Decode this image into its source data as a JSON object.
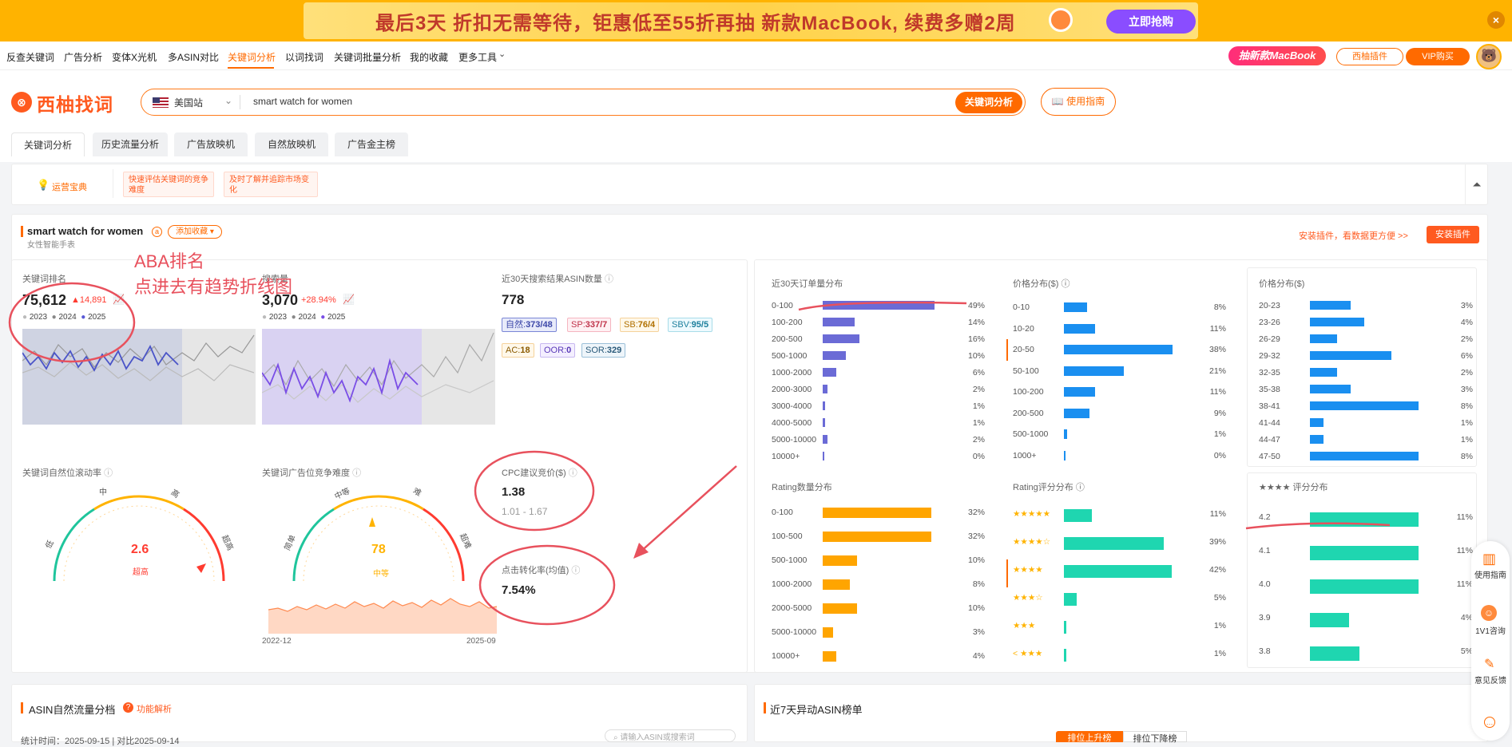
{
  "banner": {
    "text": "最后3天 折扣无需等待，钜惠低至55折再抽 新款MacBook, 续费多赠2周",
    "cta": "立即抢购",
    "close": "×"
  },
  "nav": {
    "items": [
      "反查关键词",
      "广告分析",
      "变体X光机",
      "多ASIN对比",
      "关键词分析",
      "以词找词",
      "关键词批量分析",
      "我的收藏",
      "更多工具"
    ],
    "active": "关键词分析",
    "promo": "抽新款MacBook",
    "plugin": "西柚插件",
    "vip": "VIP购买"
  },
  "search": {
    "logo": "西柚找词",
    "site": "美国站",
    "query": "smart watch for women",
    "button": "关键词分析",
    "guide": "使用指南"
  },
  "tabs": [
    "关键词分析",
    "历史流量分析",
    "广告放映机",
    "自然放映机",
    "广告金主榜"
  ],
  "tips": {
    "title": "运营宝典",
    "items": [
      "快速评估关键词的竞争难度",
      "及时了解并追踪市场变化"
    ]
  },
  "keyword": {
    "name": "smart watch for women",
    "translation": "女性智能手表",
    "fav": "添加收藏",
    "install_hint": "安装插件，看数据更方便 >>",
    "install_btn": "安装插件"
  },
  "aba": {
    "label": "关键词排名",
    "value": "75,612",
    "change": "▲14,891",
    "years": [
      "2023",
      "2024",
      "2025"
    ]
  },
  "search_vol": {
    "label": "搜索量",
    "value": "3,070",
    "change": "+28.94%",
    "years": [
      "2023",
      "2024",
      "2025"
    ]
  },
  "asin_count": {
    "label": "近30天搜索结果ASIN数量",
    "value": "778",
    "chips": [
      {
        "k": "自然",
        "v": "373/48"
      },
      {
        "k": "SP",
        "v": "337/7"
      },
      {
        "k": "SB",
        "v": "76/4"
      },
      {
        "k": "SBV",
        "v": "95/5"
      },
      {
        "k": "AC",
        "v": "18"
      },
      {
        "k": "OOR",
        "v": "0"
      },
      {
        "k": "SOR",
        "v": "329"
      }
    ]
  },
  "natural_rank": {
    "label": "关键词自然位滚动率",
    "value": "2.6",
    "level": "超高",
    "gauge": [
      "低",
      "中",
      "高",
      "超高"
    ]
  },
  "ad_compete": {
    "label": "关键词广告位竞争难度",
    "value": "78",
    "level": "中等",
    "gauge": [
      "简单",
      "中等",
      "难",
      "超难"
    ],
    "x_start": "2022-12",
    "x_end": "2025-09"
  },
  "cpc": {
    "label": "CPC建议竞价($)",
    "value": "1.38",
    "range": "1.01 - 1.67"
  },
  "cvr": {
    "label": "点击转化率(均值)",
    "value": "7.54%"
  },
  "orders_dist": {
    "title": "近30天订单量分布",
    "rows": [
      [
        "0-100",
        "49%"
      ],
      [
        "100-200",
        "14%"
      ],
      [
        "200-500",
        "16%"
      ],
      [
        "500-1000",
        "10%"
      ],
      [
        "1000-2000",
        "6%"
      ],
      [
        "2000-3000",
        "2%"
      ],
      [
        "3000-4000",
        "1%"
      ],
      [
        "4000-5000",
        "1%"
      ],
      [
        "5000-10000",
        "2%"
      ],
      [
        "10000+",
        "0%"
      ]
    ]
  },
  "price_dist": {
    "title": "价格分布($)",
    "rows": [
      [
        "0-10",
        "8%"
      ],
      [
        "10-20",
        "11%"
      ],
      [
        "20-50",
        "38%"
      ],
      [
        "50-100",
        "21%"
      ],
      [
        "100-200",
        "11%"
      ],
      [
        "200-500",
        "9%"
      ],
      [
        "500-1000",
        "1%"
      ],
      [
        "1000+",
        "0%"
      ]
    ]
  },
  "price_dist2": {
    "title": "价格分布($)",
    "rows": [
      [
        "20-23",
        "3%"
      ],
      [
        "23-26",
        "4%"
      ],
      [
        "26-29",
        "2%"
      ],
      [
        "29-32",
        "6%"
      ],
      [
        "32-35",
        "2%"
      ],
      [
        "35-38",
        "3%"
      ],
      [
        "38-41",
        "8%"
      ],
      [
        "41-44",
        "1%"
      ],
      [
        "44-47",
        "1%"
      ],
      [
        "47-50",
        "8%"
      ]
    ]
  },
  "rating_count": {
    "title": "Rating数量分布",
    "rows": [
      [
        "0-100",
        "32%"
      ],
      [
        "100-500",
        "32%"
      ],
      [
        "500-1000",
        "10%"
      ],
      [
        "1000-2000",
        "8%"
      ],
      [
        "2000-5000",
        "10%"
      ],
      [
        "5000-10000",
        "3%"
      ],
      [
        "10000+",
        "4%"
      ]
    ]
  },
  "rating_score": {
    "title": "Rating评分分布",
    "rows": [
      [
        "★★★★★",
        "11%"
      ],
      [
        "★★★★☆",
        "39%"
      ],
      [
        "★★★★",
        "42%"
      ],
      [
        "★★★☆",
        "5%"
      ],
      [
        "★★★",
        "1%"
      ],
      [
        "< ★★★",
        "1%"
      ]
    ]
  },
  "score_dist": {
    "title": "★★★★ 评分分布",
    "rows": [
      [
        "4.2",
        "11%"
      ],
      [
        "4.1",
        "11%"
      ],
      [
        "4.0",
        "11%"
      ],
      [
        "3.9",
        "4%"
      ],
      [
        "3.8",
        "5%"
      ]
    ]
  },
  "bottom": {
    "left_title": "ASIN自然流量分档",
    "left_link": "功能解析",
    "stat_time": "统计时间：2025-09-15  |  对比2025-09-14",
    "search_ph": "请输入ASIN或搜索词",
    "right_title": "近7天异动ASIN榜单",
    "tab1": "排位上升榜",
    "tab2": "排位下降榜"
  },
  "annotation": {
    "line1": "ABA排名",
    "line2": "点进去有趋势折线图"
  },
  "side": [
    "使用指南",
    "1V1咨询",
    "意见反馈"
  ],
  "colors": {
    "accent": "#ff6a00",
    "purple_bar": "#6b6bd6",
    "blue_bar": "#1a8ff0",
    "orange_bar": "#ffa500",
    "teal_bar": "#1fd6b0",
    "annot": "#e8515d"
  }
}
